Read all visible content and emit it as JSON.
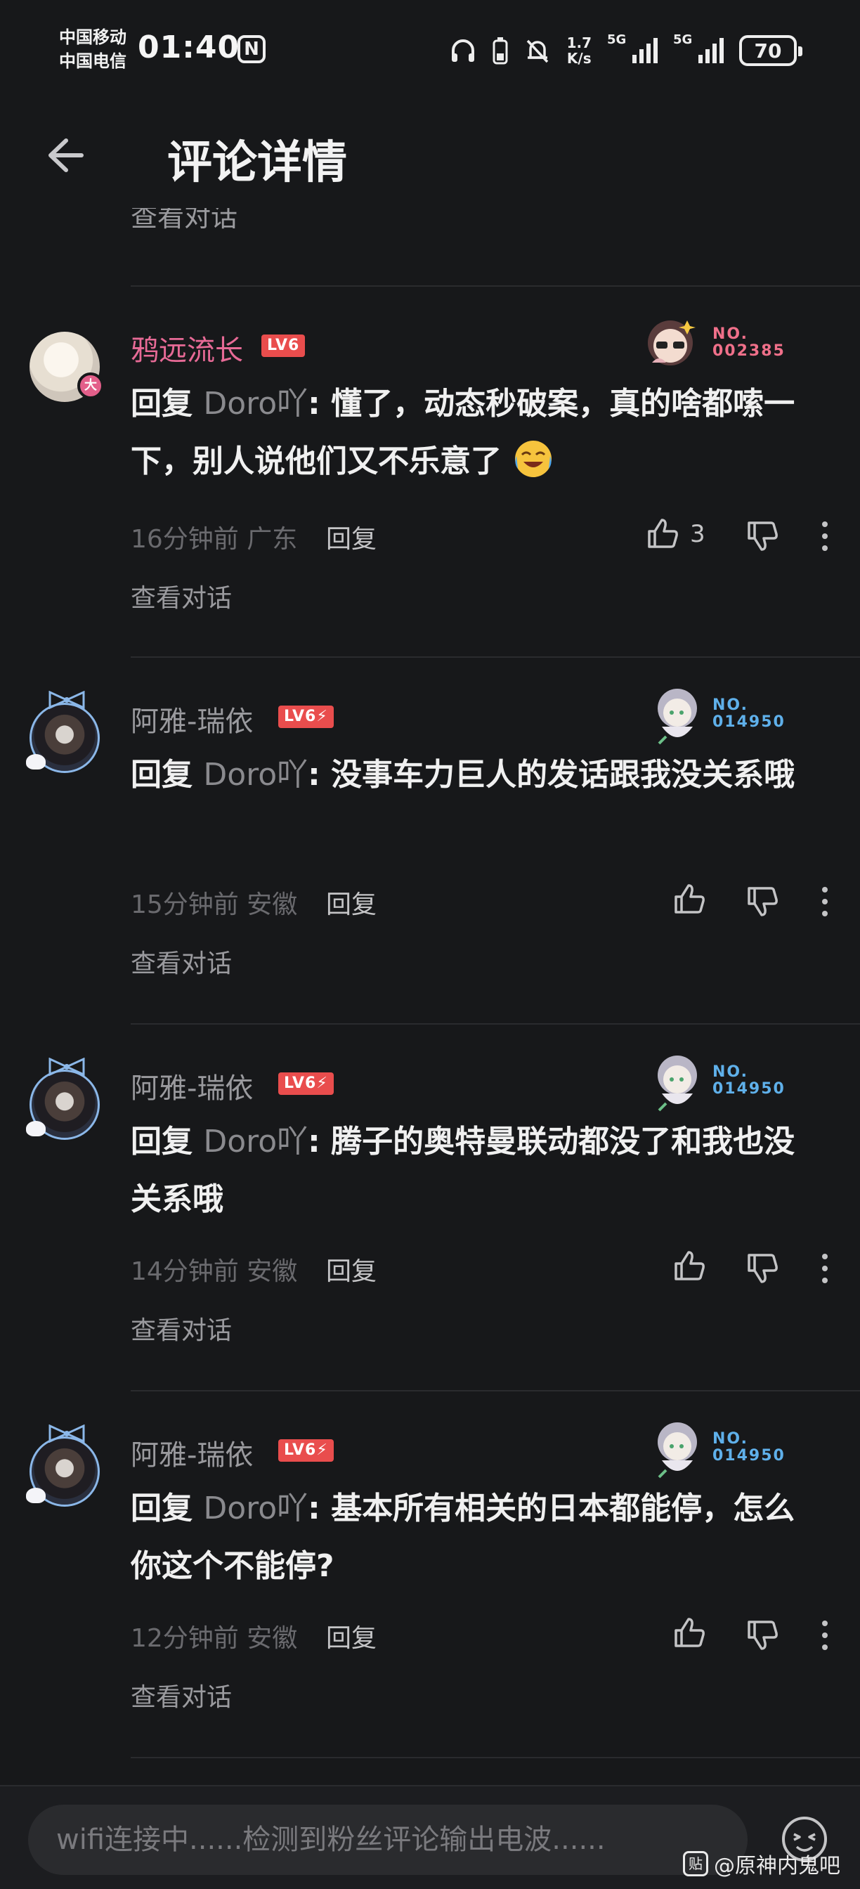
{
  "status_bar": {
    "carrier_1": "中国移动",
    "carrier_2": "中国电信",
    "time": "01:40",
    "nfc": "N",
    "net_speed_value": "1.7",
    "net_speed_unit": "K/s",
    "signal_1": "5G",
    "signal_2": "5G",
    "battery": "70"
  },
  "header": {
    "title": "评论详情",
    "back_icon": "arrow-left-icon"
  },
  "top_view_link": "查看对话",
  "comments": [
    {
      "username": "鸦远流长",
      "level": "LV6",
      "avatar_badge": "大",
      "flair_no": "NO.",
      "flair_number": "002385",
      "prefix": "回复",
      "mention": "Doro吖",
      "text": ": 懂了，动态秒破案，真的啥都嗦一下，别人说他们又不乐意了",
      "emoji": "laughing-crying-emoji",
      "time": "16分钟前",
      "location": "广东",
      "reply": "回复",
      "likes": "3",
      "view": "查看对话"
    },
    {
      "username": "阿雅-瑞依",
      "level": "LV6⚡",
      "flair_no": "NO.",
      "flair_number": "014950",
      "prefix": "回复",
      "mention": "Doro吖",
      "text": ": 没事车力巨人的发话跟我没关系哦",
      "time": "15分钟前",
      "location": "安徽",
      "reply": "回复",
      "likes": "",
      "view": "查看对话"
    },
    {
      "username": "阿雅-瑞依",
      "level": "LV6⚡",
      "flair_no": "NO.",
      "flair_number": "014950",
      "prefix": "回复",
      "mention": "Doro吖",
      "text": ": 腾子的奥特曼联动都没了和我也没关系哦",
      "time": "14分钟前",
      "location": "安徽",
      "reply": "回复",
      "likes": "",
      "view": "查看对话"
    },
    {
      "username": "阿雅-瑞依",
      "level": "LV6⚡",
      "flair_no": "NO.",
      "flair_number": "014950",
      "prefix": "回复",
      "mention": "Doro吖",
      "text": ": 基本所有相关的日本都能停，怎么你这个不能停?",
      "time": "12分钟前",
      "location": "安徽",
      "reply": "回复",
      "likes": "",
      "view": "查看对话"
    }
  ],
  "input": {
    "placeholder": "wifi连接中......检测到粉丝评论输出电波......"
  },
  "watermark": {
    "badge": "贴",
    "text": "@原神内鬼吧"
  },
  "colors": {
    "background": "#17181a",
    "username_pink": "#e76a96",
    "level_badge": "#e94d4d",
    "flair_red": "#f0708a",
    "flair_blue": "#5fb0ea"
  }
}
